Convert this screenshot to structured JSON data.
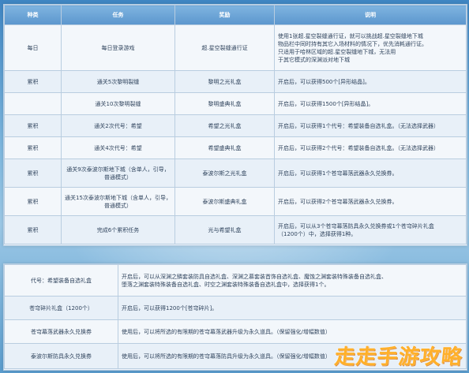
{
  "table1": {
    "headers": [
      "种类",
      "任务",
      "奖励",
      "说明"
    ],
    "rows": [
      {
        "type": "每日",
        "task": "每日登录游戏",
        "reward": "超.星空裂缝通行证",
        "desc": [
          "使用1张超.星空裂缝通行证，就可以挑战超.星空裂缝地下城",
          "物品栏中同时持有其它入场材料的情况下，优先消耗通行证。",
          "只适用于哈林区域的超.星空裂缝地下城，无法用",
          "于其它模式的深渊派对地下城"
        ]
      },
      {
        "type": "累积",
        "task": "通关5次黎明裂缝",
        "reward": "黎明之光礼盒",
        "desc": [
          "开启后，可以获得500个[异形结晶]。"
        ]
      },
      {
        "type": "",
        "task": "通关10次黎明裂缝",
        "reward": "黎明盛典礼盒",
        "desc": [
          "开启后，可以获得1500个[异形结晶]。"
        ]
      },
      {
        "type": "累积",
        "task": "通关2次代号：希望",
        "reward": "希望之光礼盒",
        "desc": [
          "开启后，可以获得1个代号：希望装备自选礼盒。（无法选择武器）"
        ]
      },
      {
        "type": "累积",
        "task": "通关4次代号：希望",
        "reward": "希望盛典礼盒",
        "desc": [
          "开启后，可以获得2个代号：希望装备自选礼盒。（无法选择武器）"
        ]
      },
      {
        "type": "累积",
        "task": "通关9次泰波尔斯地下城（含单人，引导，普通模式）",
        "reward": "泰波尔斯之光礼盒",
        "desc": [
          "开启后，可以获得1个苍穹幕落武器永久兑换券。"
        ]
      },
      {
        "type": "累积",
        "task": "通关15次泰波尔斯地下城（含单人，引导，普通模式）",
        "reward": "泰波尔斯盛典礼盒",
        "desc": [
          "开启后，可以获得2个苍穹幕落武器永久兑换券。"
        ]
      },
      {
        "type": "累积",
        "task": "完成6个累积任务",
        "reward": "光与希望礼盒",
        "desc": [
          "开启后，可以从3个苍穹幕落防具永久兑换券或1个苍穹碎片礼盒",
          "（1200个）中，选择获得1种。"
        ]
      }
    ]
  },
  "table2": {
    "rows": [
      {
        "name": "代号：希望装备自选礼盒",
        "desc": [
          "开启后，可以从深渊之鳞套装防具自选礼盒、深渊之慕套装首饰自选礼盒、魔蚀之渊套装特殊装备自选礼盒、",
          "堕落之渊套装特殊装备自选礼盒、时空之渊套装特殊装备自选礼盒中，选择获得1个。"
        ]
      },
      {
        "name": "苍穹碎片礼盒（1200个）",
        "desc": [
          "开启后，可以获得1200个[苍穹碎片]。"
        ]
      },
      {
        "name": "苍穹幕落武器永久兑换券",
        "desc": [
          "使用后，可以将所选的有限期的苍穹幕落武器升级为永久道具。（保留强化/增幅数值）"
        ]
      },
      {
        "name": "泰波尔斯防具永久兑换券",
        "desc": [
          "使用后，可以将所选的有限期的苍穹幕落防具升级为永久道具。（保留强化/增幅数值）"
        ]
      }
    ]
  },
  "watermark": "走走手游攻略",
  "colors": {
    "header": "#6aa5da",
    "accent_red": "#c0392b",
    "watermark": "#ffb02a"
  }
}
